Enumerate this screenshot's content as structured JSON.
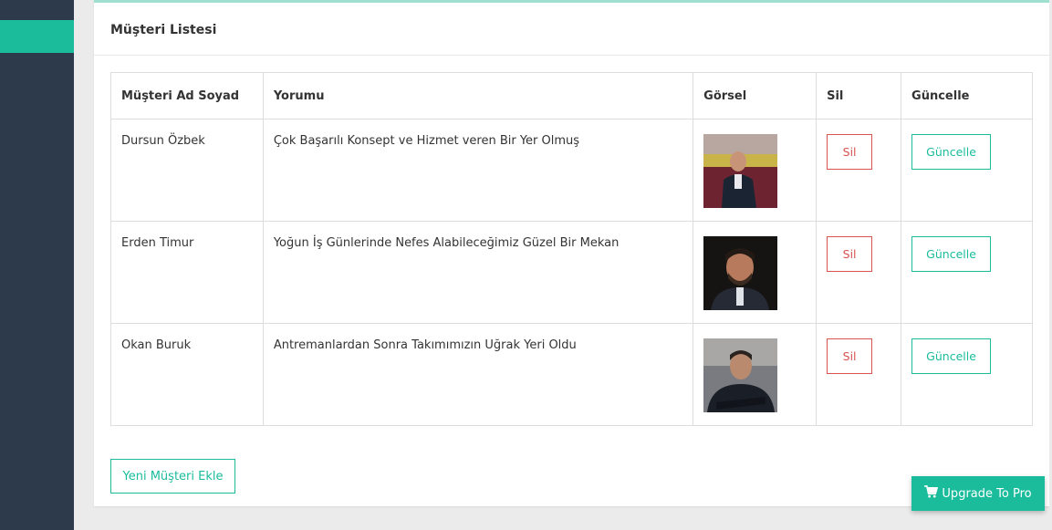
{
  "panel": {
    "title": "Müşteri Listesi"
  },
  "table": {
    "headers": [
      "Müşteri Ad Soyad",
      "Yorumu",
      "Görsel",
      "Sil",
      "Güncelle"
    ],
    "rows": [
      {
        "name": "Dursun Özbek",
        "comment": "Çok Başarılı Konsept ve Hizmet veren Bir Yer Olmuş",
        "delete_label": "Sil",
        "update_label": "Güncelle"
      },
      {
        "name": "Erden Timur",
        "comment": "Yoğun İş Günlerinde Nefes Alabileceğimiz Güzel Bir Mekan",
        "delete_label": "Sil",
        "update_label": "Güncelle"
      },
      {
        "name": "Okan Buruk",
        "comment": "Antremanlardan Sonra Takımımızın Uğrak Yeri Oldu",
        "delete_label": "Sil",
        "update_label": "Güncelle"
      }
    ]
  },
  "add_button_label": "Yeni Müşteri Ekle",
  "upgrade_label": "Upgrade To Pro",
  "colors": {
    "accent": "#1abc9c",
    "danger": "#d9534f",
    "sidebar": "#2c3a4b"
  }
}
